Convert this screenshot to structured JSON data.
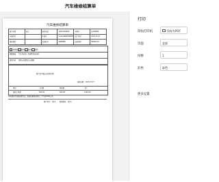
{
  "app": {
    "title": "汽车维修结算单"
  },
  "document": {
    "title": "汽车维修结算单",
    "header_rows": [
      [
        "客户名称",
        "张大",
        "联系电话",
        "18921568900",
        "车牌号",
        "苏A88888"
      ],
      [
        "车辆型号",
        "",
        "车架号",
        "LSVAA8888A8888888",
        "进厂时间",
        "2020-07-07"
      ],
      [
        "维修类别",
        "",
        "发动机号",
        "8888888",
        "送修里程",
        "88888 KM"
      ]
    ],
    "fault_label": "故障描述",
    "fault_text": "汽车不启动，需要检查发动机",
    "repair_label": "维修内容",
    "repair_text": "更换火花塞及点火线圈",
    "options": [
      "质保期",
      "首保",
      "返修",
      "保险"
    ],
    "customer_note": "客户签字确认已收到车辆",
    "date_note": "结算日期：2020-07-07",
    "table_headers": [
      "项目",
      "工时费",
      "材料费",
      "小计"
    ],
    "table_row": [
      "维修工时费",
      "800.00",
      "600.00",
      "1400.00"
    ],
    "footer_lines": [
      "本单据仅作维修结算凭证，维修质量保证期为三个月或5000公里",
      "客户签字：（签字）　　服务顾问：（签字）"
    ]
  },
  "print_panel": {
    "header": "打印",
    "rows": [
      {
        "label": "目标打印机",
        "value": "另存为PDF"
      },
      {
        "label": "页面",
        "value": "全部"
      },
      {
        "label": "份数",
        "value": "1"
      },
      {
        "label": "彩色",
        "value": "彩色"
      }
    ],
    "more": "更多设置"
  },
  "colors": {
    "panel_border": "#e0e0e0",
    "preview_bg": "#f2f2f2"
  }
}
